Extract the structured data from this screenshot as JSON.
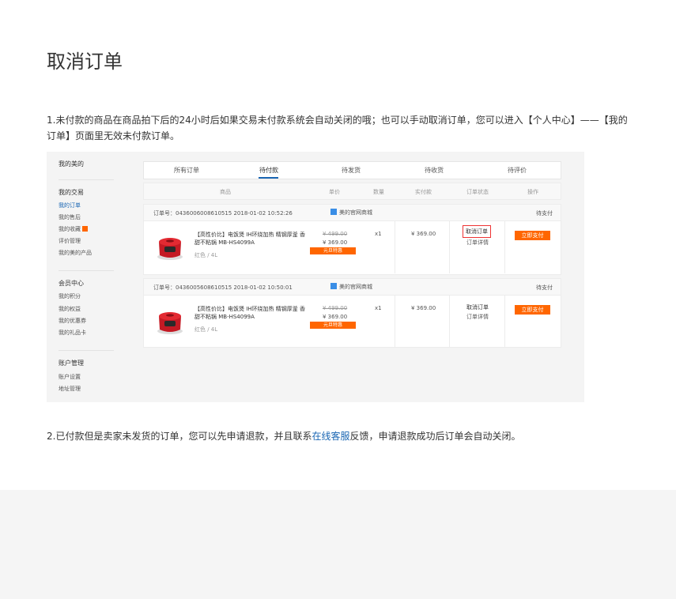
{
  "title": "取消订单",
  "para1": "1.未付款的商品在商品拍下后的24小时后如果交易未付款系统会自动关闭的哦；也可以手动取消订单，您可以进入【个人中心】——【我的订单】页面里无效未付款订单。",
  "para2": {
    "before": "2.已付款但是卖家未发货的订单，您可以先申请退款，并且联系",
    "link": "在线客服",
    "after": "反馈，申请退款成功后订单会自动关闭。"
  },
  "shot": {
    "sidebar": {
      "g1_title": "我的美的",
      "g2_title": "我的交易",
      "g2_items": [
        "我的订单",
        "我的售后",
        "我的收藏",
        "评价管理",
        "我的美的产品"
      ],
      "g3_title": "会员中心",
      "g3_items": [
        "我的积分",
        "我的权益",
        "我的优惠券",
        "我的礼品卡"
      ],
      "g4_title": "账户管理",
      "g4_items": [
        "账户设置",
        "地址管理"
      ]
    },
    "tabs": [
      "所有订单",
      "待付款",
      "待发货",
      "待收货",
      "待评价"
    ],
    "headers": [
      "商品",
      "单价",
      "数量",
      "实付款",
      "订单状态",
      "操作"
    ],
    "orders": [
      {
        "number": "订单号：0436006008610515   2018-01-02 10:52:26",
        "shop": "美的官网商城",
        "status": "待支付",
        "name": "【高性价比】电饭煲 IH环绕加热 精钢厚釜 香甜不粘锅 MB-HS4099A",
        "spec": "红色 / 4L",
        "price_old": "¥ 499.00",
        "price_new": "¥ 369.00",
        "badge": "元旦特惠",
        "qty": "x1",
        "paid": "¥ 369.00",
        "act1": "取消订单",
        "act2": "订单详情",
        "pay": "立即支付"
      },
      {
        "number": "订单号：0436005608610515   2018-01-02 10:50:01",
        "shop": "美的官网商城",
        "status": "待支付",
        "name": "【高性价比】电饭煲 IH环绕加热 精钢厚釜 香甜不粘锅 MB-HS4099A",
        "spec": "红色 / 4L",
        "price_old": "¥ 499.00",
        "price_new": "¥ 369.00",
        "badge": "元旦特惠",
        "qty": "x1",
        "paid": "¥ 369.00",
        "act1": "取消订单",
        "act2": "订单详情",
        "pay": "立即支付"
      }
    ]
  },
  "colors": {
    "accent": "#1a66b3",
    "orange": "#ff6600",
    "highlight": "#ee3333"
  }
}
